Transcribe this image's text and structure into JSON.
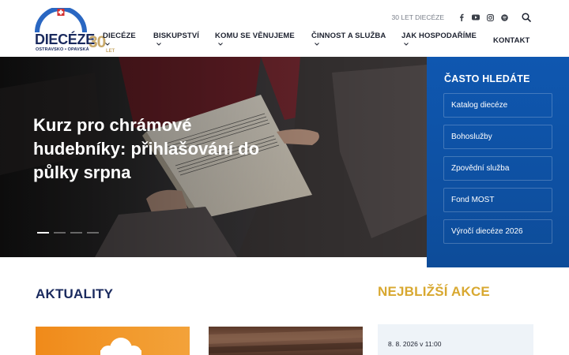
{
  "logo": {
    "title": "DIECÉZE",
    "subtitle": "OSTRAVSKO • OPAVSKÁ",
    "anniversary_number": "30",
    "anniversary_word": "LET"
  },
  "topbar": {
    "anniversary_link": "30 LET DIECÉZE",
    "social": [
      "facebook-icon",
      "youtube-icon",
      "instagram-icon",
      "spotify-icon"
    ]
  },
  "nav": {
    "items": [
      {
        "label": "DIECÉZE"
      },
      {
        "label": "BISKUPSTVÍ"
      },
      {
        "label": "KOMU SE VĚNUJEME"
      },
      {
        "label": "ČINNOST A SLUŽBA"
      },
      {
        "label": "JAK HOSPODAŘÍME"
      },
      {
        "label": "KONTAKT"
      }
    ]
  },
  "hero": {
    "title": "Kurz pro chrámové hudebníky: přihlašování do půlky srpna",
    "slides_count": 4,
    "active_slide": 1
  },
  "frequent": {
    "title": "ČASTO HLEDÁTE",
    "items": [
      {
        "label": "Katalog diecéze"
      },
      {
        "label": "Bohoslužby"
      },
      {
        "label": "Zpovědní služba"
      },
      {
        "label": "Fond MOST"
      },
      {
        "label": "Výročí diecéze 2026"
      }
    ]
  },
  "news": {
    "title": "AKTUALITY"
  },
  "events": {
    "title": "NEJBLIŽŠÍ AKCE",
    "first_date": "8. 8. 2026 v 11:00"
  },
  "colors": {
    "navy": "#1a2a5e",
    "gold": "#d8a830",
    "panel_blue": "#0f57b0",
    "logo_red": "#d32f2f"
  }
}
